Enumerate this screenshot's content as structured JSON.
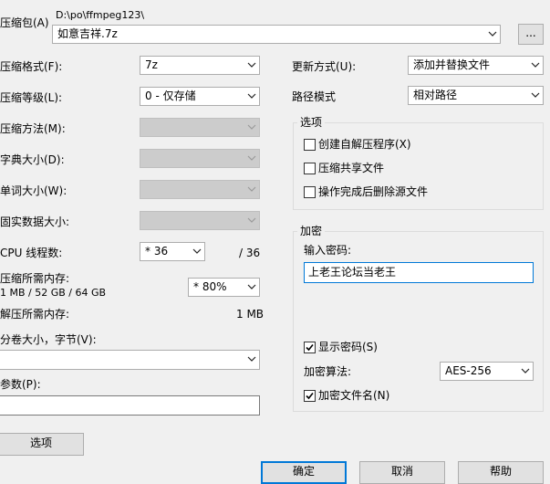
{
  "archive": {
    "label": "压缩包(A)",
    "path": "D:\\po\\ffmpeg123\\",
    "name": "如意吉祥.7z",
    "browse_label": "..."
  },
  "left": {
    "format_label": "压缩格式(F):",
    "format_value": "7z",
    "level_label": "压缩等级(L):",
    "level_value": "0 - 仅存储",
    "method_label": "压缩方法(M):",
    "dict_label": "字典大小(D):",
    "word_label": "单词大小(W):",
    "solid_label": "固实数据大小:",
    "cpu_label": "CPU 线程数:",
    "cpu_value": "* 36",
    "cpu_total": "/ 36",
    "mem_comp_label": "压缩所需内存:",
    "mem_comp_detail": "1 MB / 52 GB / 64 GB",
    "mem_comp_value": "* 80%",
    "mem_decomp_label": "解压所需内存:",
    "mem_decomp_value": "1 MB",
    "split_label": "分卷大小，字节(V):",
    "split_value": "",
    "params_label": "参数(P):",
    "params_value": "",
    "options_button": "选项"
  },
  "right": {
    "update_label": "更新方式(U):",
    "update_value": "添加并替换文件",
    "pathmode_label": "路径模式",
    "pathmode_value": "相对路径",
    "options_group": {
      "title": "选项",
      "sfx": {
        "label": "创建自解压程序(X)",
        "checked": false
      },
      "shared": {
        "label": "压缩共享文件",
        "checked": false
      },
      "delete_after": {
        "label": "操作完成后删除源文件",
        "checked": false
      }
    },
    "encrypt_group": {
      "title": "加密",
      "password_label": "输入密码:",
      "password_value": "上老王论坛当老王",
      "show_password": {
        "label": "显示密码(S)",
        "checked": true
      },
      "method_label": "加密算法:",
      "method_value": "AES-256",
      "encrypt_names": {
        "label": "加密文件名(N)",
        "checked": true
      }
    }
  },
  "footer": {
    "ok": "确定",
    "cancel": "取消",
    "help": "帮助"
  }
}
